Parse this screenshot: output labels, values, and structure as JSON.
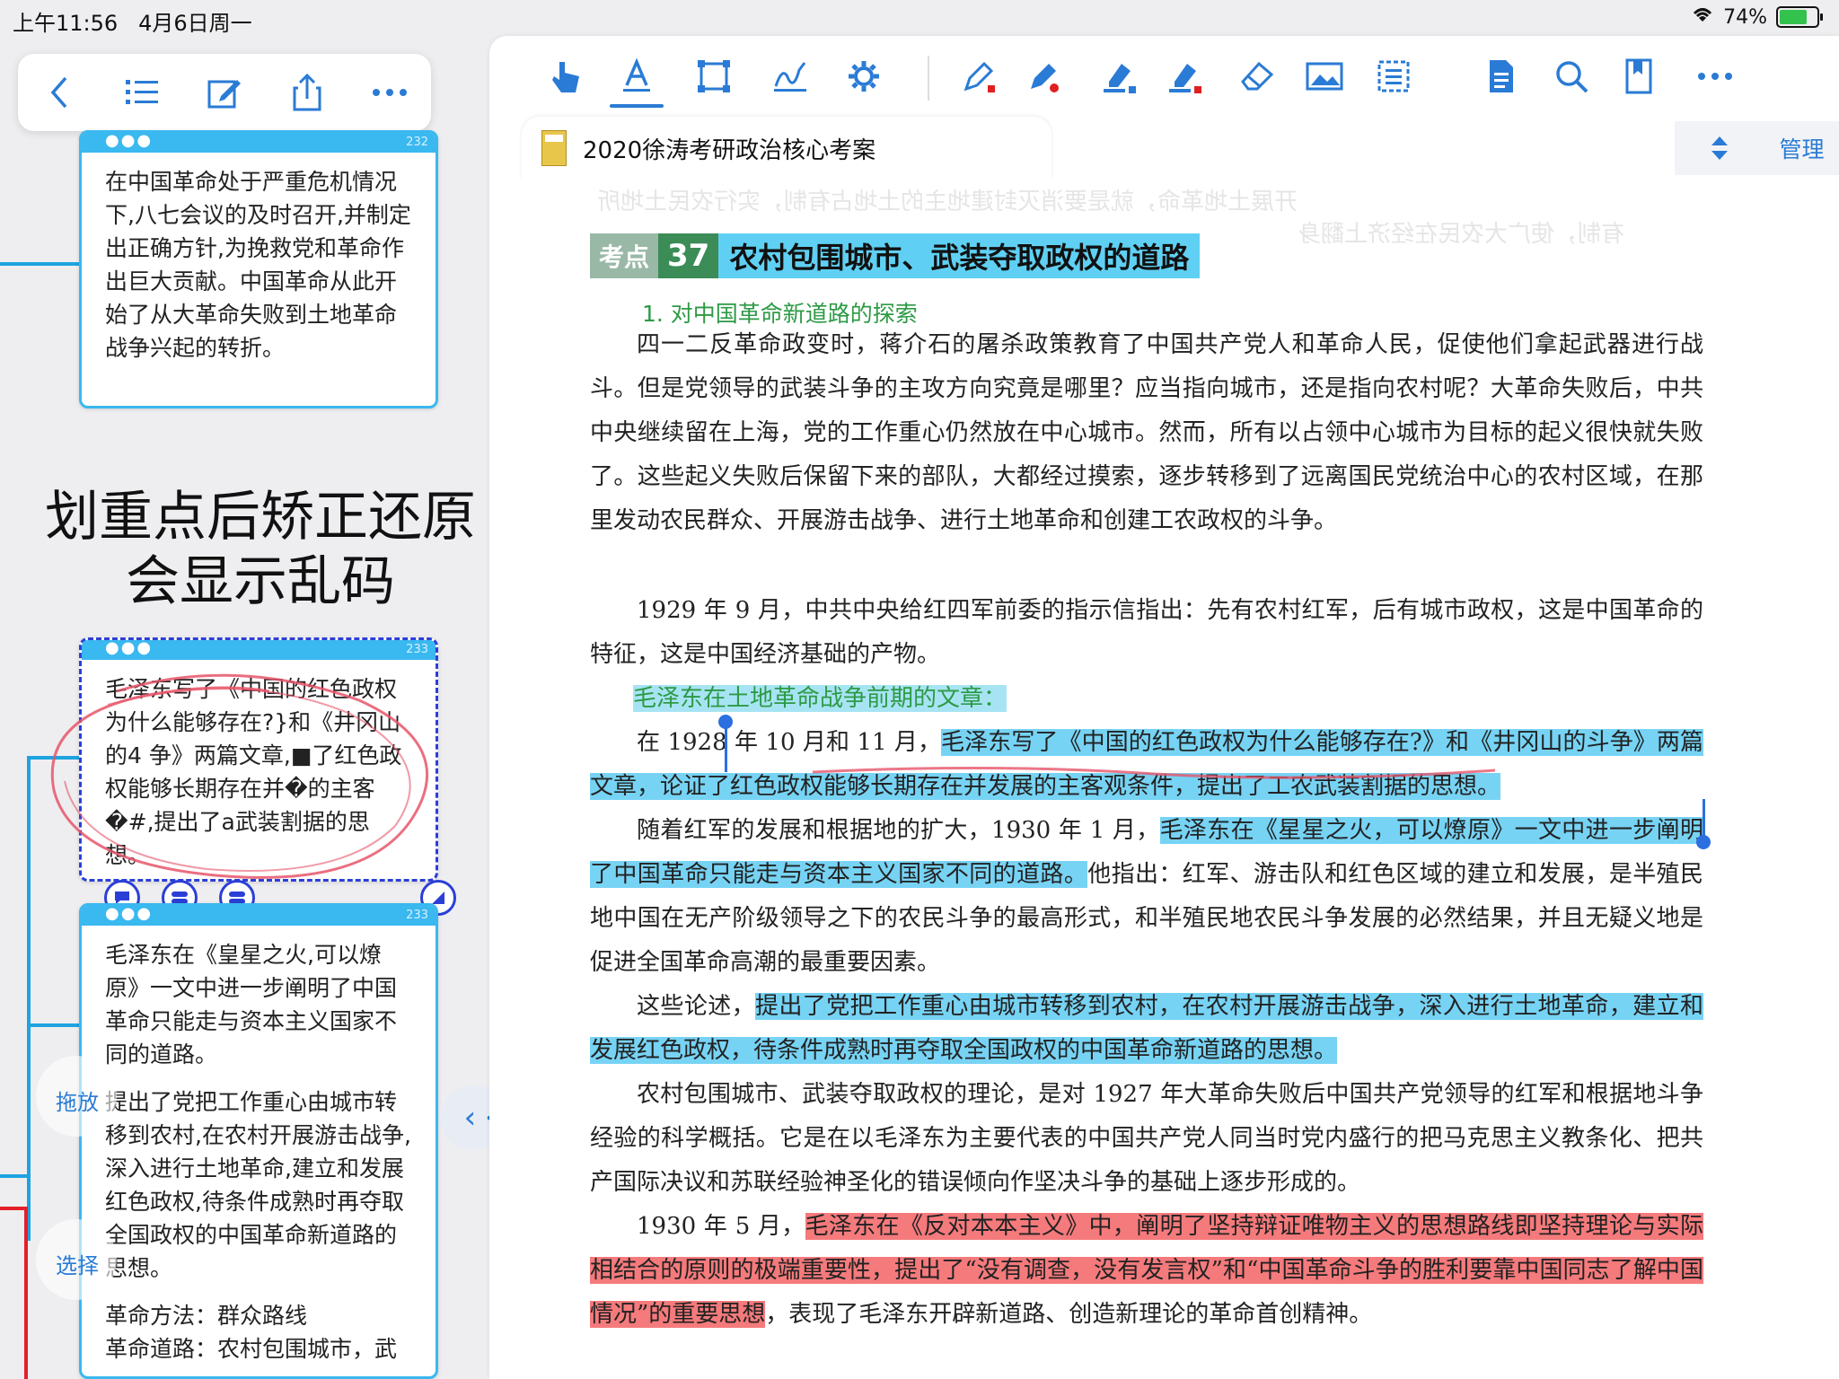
{
  "status_bar": {
    "time": "上午11:56",
    "date": "4月6日周一",
    "battery": "74%"
  },
  "left_toolbar": {
    "icons": [
      "back-icon",
      "outline-list-icon",
      "edit-icon",
      "share-icon",
      "more-icon"
    ]
  },
  "cards": [
    {
      "page": "232",
      "paras": [
        "在中国革命处于严重危机情况下,八七会议的及时召开,并制定出正确方针,为挽救党和革命作出巨大贡献。中国革命从此开始了从大革命失败到土地革命战争兴起的转折。"
      ]
    },
    {
      "page": "233",
      "paras": [
        "毛泽东写了《中国的红色政权为什么能够存在?}和《井冈山的4 争》两篇文章,■了红色政权能够长期存在并�的主客�#,提出了a武装割据的思想。"
      ]
    },
    {
      "page": "233",
      "paras": [
        "毛泽东在《皇星之火,可以燎原》一文中进一步阐明了中国革命只能走与资本主义国家不同的道路。",
        "提出了党把工作重心由城市转移到农村,在农村开展游击战争,深入进行土地革命,建立和发展红色政权,待条件成熟时再夺取全国政权的中国革命新道路的思想。",
        "革命方法：群众路线",
        "革命道路：农村包围城市，武"
      ]
    }
  ],
  "overlay_text": {
    "line1": "划重点后矫正还原",
    "line2": "会显示乱码"
  },
  "side_labels": {
    "drag": "拖放",
    "select": "选择"
  },
  "doc_toolbar": {
    "icons": [
      "hand-pointer-icon",
      "text-highlight-icon",
      "rect-select-icon",
      "signature-icon",
      "settings-gear-icon",
      "pen-red-icon",
      "pen-red-2-icon",
      "highlighter-blue-icon",
      "highlighter-red-icon",
      "eraser-icon",
      "image-icon",
      "ocr-icon",
      "document-icon",
      "search-icon",
      "bookmark-icon",
      "more-icon"
    ]
  },
  "tab": {
    "title": "2020徐涛考研政治核心考案",
    "manage_label": "管理"
  },
  "document": {
    "ghost_lines": [
      "开展土地革命，就是要消灭封建地主的土地占有制，实行农民土地所",
      "有制，使广大农民在经济上翻身"
    ],
    "heading": {
      "tag": "考点",
      "num": "37",
      "text": "农村包围城市、武装夺取政权的道路"
    },
    "subhead": "1. 对中国革命新道路的探索",
    "p1": "四一二反革命政变时，蒋介石的屠杀政策教育了中国共产党人和革命人民，促使他们拿起武器进行战斗。但是党领导的武装斗争的主攻方向究竟是哪里？应当指向城市，还是指向农村呢？大革命失败后，中共中央继续留在上海，党的工作重心仍然放在中心城市。然而，所有以占领中心城市为目标的起义很快就失败了。这些起义失败后保留下来的部队，大都经过摸索，逐步转移到了远离国民党统治中心的农村区域，在那里发动农民群众、开展游击战争、进行土地革命和创建工农政权的斗争。",
    "p2": "1929 年 9 月，中共中央给红四军前委的指示信指出：先有农村红军，后有城市政权，这是中国革命的特征，这是中国经济基础的产物。",
    "hl_green": "毛泽东在土地革命战争前期的文章：",
    "p3_pre": "在 1928 年 10 月和 11 月，",
    "p3_hl": "毛泽东写了《中国的红色政权为什么能够存在?》和《井冈山的斗争》两篇文章，论证了红色政权能够长期存在并发展的主客观条件，提出了工农武装割据的思想。",
    "p4_pre": "随着红军的发展和根据地的扩大，1930 年 1 月，",
    "p4_hl": "毛泽东在《星星之火，可以燎原》一文中进一步阐明了中国革命只能走与资本主义国家不同的道路。",
    "p4_post": "他指出：红军、游击队和红色区域的建立和发展，是半殖民地中国在无产阶级领导之下的农民斗争的最高形式，和半殖民地农民斗争发展的必然结果，并且无疑义地是促进全国革命高潮的最重要因素。",
    "p5_pre": "这些论述，",
    "p5_hl": "提出了党把工作重心由城市转移到农村，在农村开展游击战争，深入进行土地革命，建立和发展红色政权，待条件成熟时再夺取全国政权的中国革命新道路的思想。",
    "p6": "农村包围城市、武装夺取政权的理论，是对 1927 年大革命失败后中国共产党领导的红军和根据地斗争经验的科学概括。它是在以毛泽东为主要代表的中国共产党人同当时党内盛行的把马克思主义教条化、把共产国际决议和苏联经验神圣化的错误倾向作坚决斗争的基础上逐步形成的。",
    "p7_pre": "1930 年 5 月，",
    "p7_hl": "毛泽东在《反对本本主义》中，阐明了坚持辩证唯物主义的思想路线即坚持理论与实际相结合的原则的极端重要性，提出了“没有调查，没有发言权”和“中国革命斗争的胜利要靠中国同志了解中国情况”的重要思想",
    "p7_post": "，表现了毛泽东开辟新道路、创造新理论的革命首创精神。"
  }
}
